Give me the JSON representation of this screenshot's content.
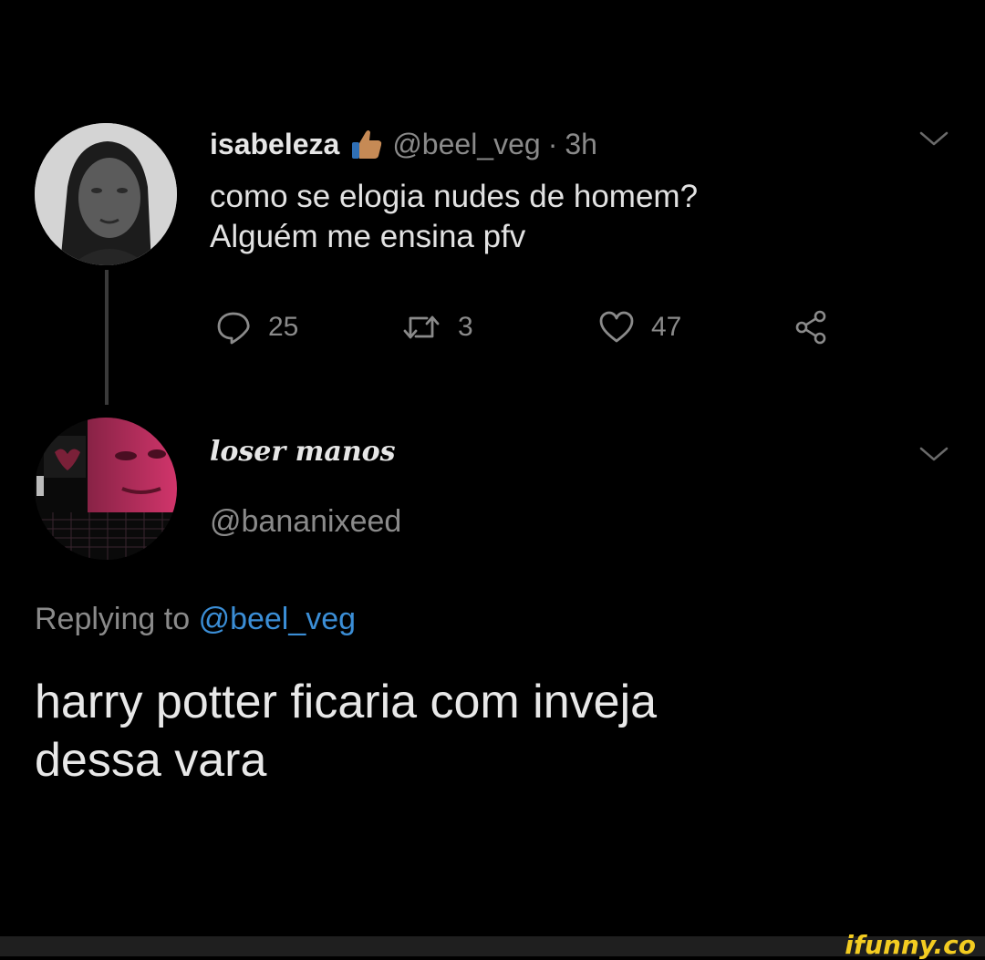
{
  "tweet": {
    "author_name": "isabeleza",
    "author_emoji": "thumbs-up-icon",
    "handle": "@beel_veg",
    "separator": "·",
    "time": "3h",
    "text_lines": [
      "como se elogia nudes de homem?",
      "Alguém me ensina pfv"
    ],
    "reply_count": "25",
    "retweet_count": "3",
    "like_count": "47",
    "icons": {
      "reply": "reply-icon",
      "retweet": "retweet-icon",
      "like": "heart-icon",
      "share": "share-icon",
      "menu": "chevron-down-icon"
    }
  },
  "reply": {
    "author_name": "loser manos",
    "handle": "@bananixeed",
    "replying_prefix": "Replying to",
    "replying_mention": "@beel_veg",
    "text_lines": [
      "harry potter ficaria com inveja",
      "dessa vara"
    ]
  },
  "watermark": "ifunny.co",
  "colors": {
    "background": "#000000",
    "primary_text": "#e2e2e2",
    "secondary_text": "#8a8a8a",
    "link": "#3b8ed6",
    "watermark": "#f3cc21"
  }
}
